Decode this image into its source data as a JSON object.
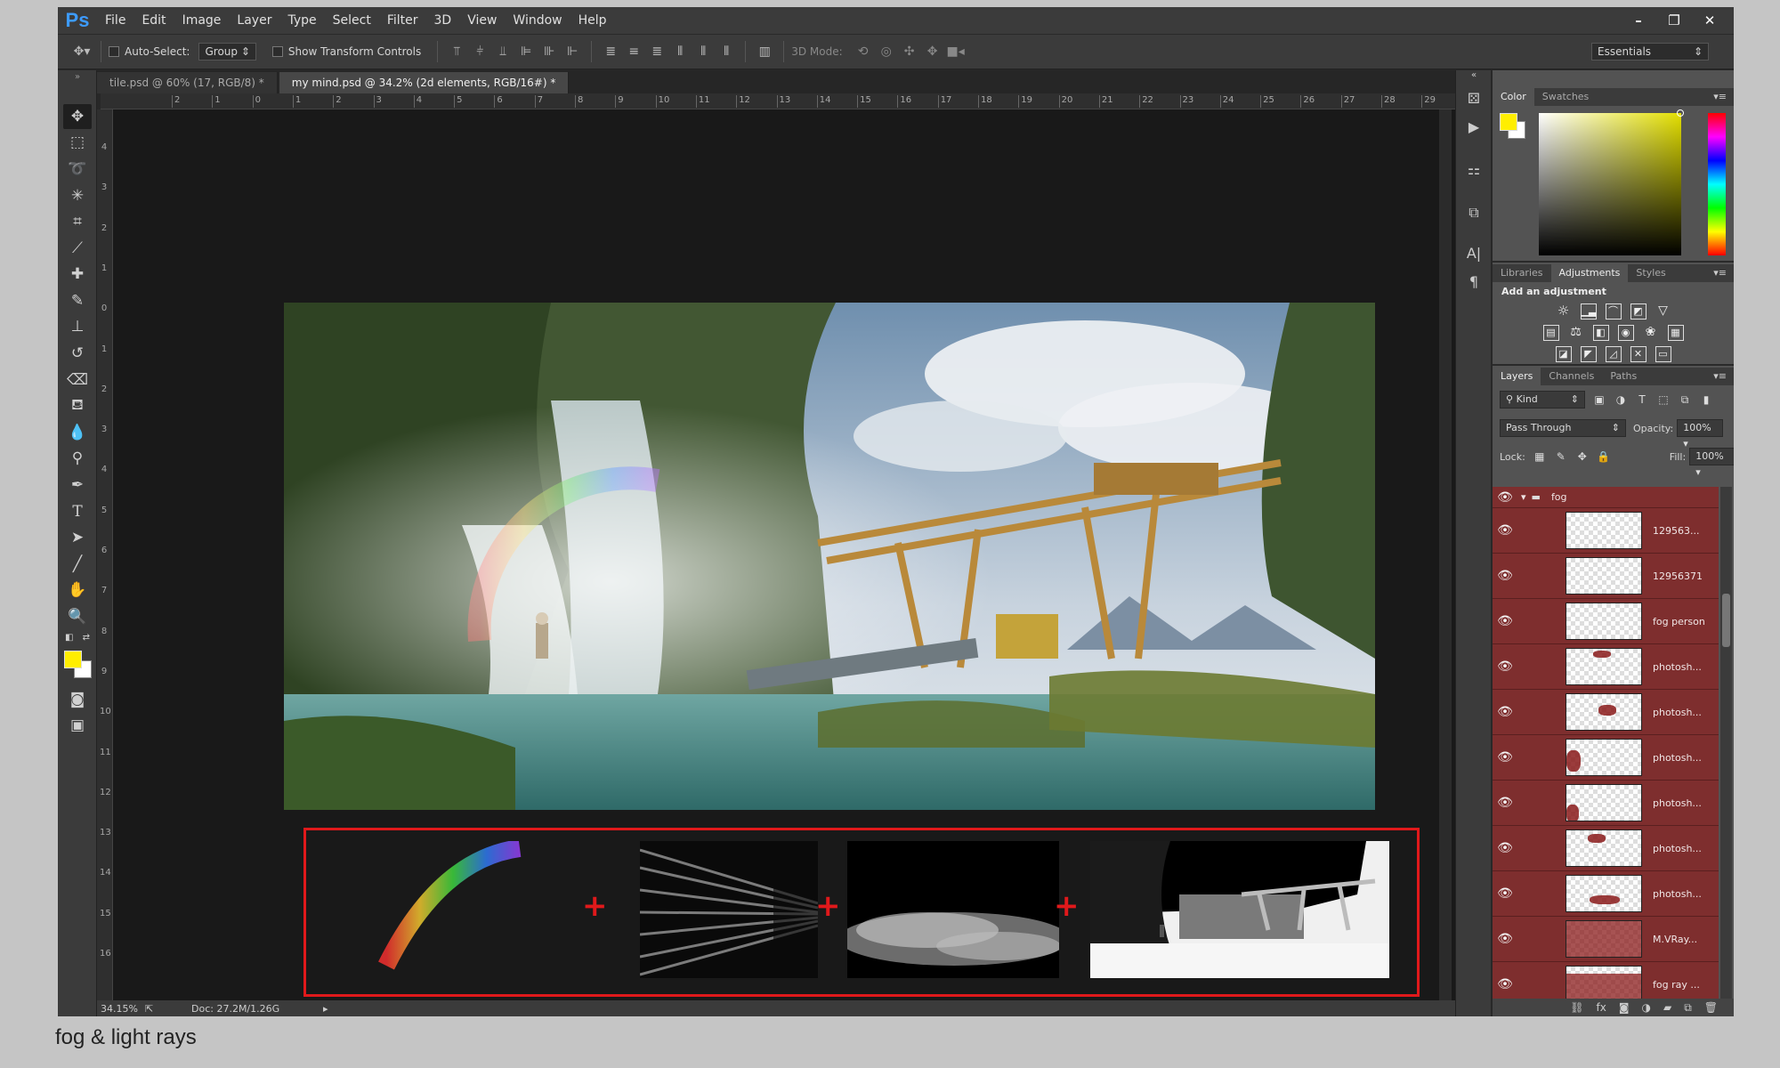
{
  "app": {
    "logo": "Ps"
  },
  "menu": [
    "File",
    "Edit",
    "Image",
    "Layer",
    "Type",
    "Select",
    "Filter",
    "3D",
    "View",
    "Window",
    "Help"
  ],
  "window_controls": [
    "–",
    "❐",
    "✕"
  ],
  "options": {
    "auto_select_label": "Auto-Select:",
    "auto_select_value": "Group",
    "transform_label": "Show Transform Controls",
    "mode_3d_label": "3D Mode:",
    "workspace": "Essentials"
  },
  "tabs": [
    {
      "label": "tile.psd @ 60% (17, RGB/8) *"
    },
    {
      "label": "my mind.psd @ 34.2% (2d elements, RGB/16#) *"
    }
  ],
  "ruler_top": [
    "2",
    "1",
    "0",
    "1",
    "2",
    "3",
    "4",
    "5",
    "6",
    "7",
    "8",
    "9",
    "10",
    "11",
    "12",
    "13",
    "14",
    "15",
    "16",
    "17",
    "18",
    "19",
    "20",
    "21",
    "22",
    "23",
    "24",
    "25",
    "26",
    "27",
    "28",
    "29"
  ],
  "ruler_left": [
    "4",
    "3",
    "2",
    "1",
    "0",
    "1",
    "2",
    "3",
    "4",
    "5",
    "6",
    "7",
    "8",
    "9",
    "10",
    "11",
    "12",
    "13",
    "14",
    "15",
    "16"
  ],
  "status": {
    "zoom": "34.15%",
    "doc": "Doc: 27.2M/1.26G"
  },
  "color_panel": {
    "tabs": [
      "Color",
      "Swatches"
    ],
    "foreground": "#ffee00",
    "background": "#ffffff"
  },
  "adjustments_panel": {
    "tabs": [
      "Libraries",
      "Adjustments",
      "Styles"
    ],
    "heading": "Add an adjustment"
  },
  "layers_panel": {
    "tabs": [
      "Layers",
      "Channels",
      "Paths"
    ],
    "filter_kind": "Kind",
    "blend_mode": "Pass Through",
    "opacity_label": "Opacity:",
    "opacity_value": "100%",
    "lock_label": "Lock:",
    "fill_label": "Fill:",
    "fill_value": "100%",
    "layers": [
      {
        "name": "fog",
        "type": "group"
      },
      {
        "name": "129563..."
      },
      {
        "name": "12956371"
      },
      {
        "name": "fog person"
      },
      {
        "name": "photosh..."
      },
      {
        "name": "photosh..."
      },
      {
        "name": "photosh..."
      },
      {
        "name": "photosh..."
      },
      {
        "name": "photosh..."
      },
      {
        "name": "photosh..."
      },
      {
        "name": "M.VRay..."
      },
      {
        "name": "fog ray ..."
      }
    ]
  },
  "caption": "fog & light rays",
  "colors": {
    "highlight": "#e0191b",
    "layer_selected": "#7e2e2e",
    "ui_dark": "#282828"
  }
}
